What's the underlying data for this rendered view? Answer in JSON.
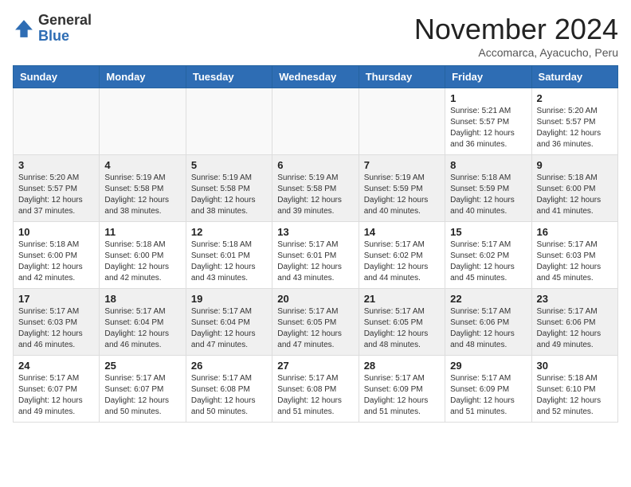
{
  "header": {
    "logo_general": "General",
    "logo_blue": "Blue",
    "month_year": "November 2024",
    "location": "Accomarca, Ayacucho, Peru"
  },
  "weekdays": [
    "Sunday",
    "Monday",
    "Tuesday",
    "Wednesday",
    "Thursday",
    "Friday",
    "Saturday"
  ],
  "weeks": [
    [
      {
        "day": "",
        "info": ""
      },
      {
        "day": "",
        "info": ""
      },
      {
        "day": "",
        "info": ""
      },
      {
        "day": "",
        "info": ""
      },
      {
        "day": "",
        "info": ""
      },
      {
        "day": "1",
        "info": "Sunrise: 5:21 AM\nSunset: 5:57 PM\nDaylight: 12 hours and 36 minutes."
      },
      {
        "day": "2",
        "info": "Sunrise: 5:20 AM\nSunset: 5:57 PM\nDaylight: 12 hours and 36 minutes."
      }
    ],
    [
      {
        "day": "3",
        "info": "Sunrise: 5:20 AM\nSunset: 5:57 PM\nDaylight: 12 hours and 37 minutes."
      },
      {
        "day": "4",
        "info": "Sunrise: 5:19 AM\nSunset: 5:58 PM\nDaylight: 12 hours and 38 minutes."
      },
      {
        "day": "5",
        "info": "Sunrise: 5:19 AM\nSunset: 5:58 PM\nDaylight: 12 hours and 38 minutes."
      },
      {
        "day": "6",
        "info": "Sunrise: 5:19 AM\nSunset: 5:58 PM\nDaylight: 12 hours and 39 minutes."
      },
      {
        "day": "7",
        "info": "Sunrise: 5:19 AM\nSunset: 5:59 PM\nDaylight: 12 hours and 40 minutes."
      },
      {
        "day": "8",
        "info": "Sunrise: 5:18 AM\nSunset: 5:59 PM\nDaylight: 12 hours and 40 minutes."
      },
      {
        "day": "9",
        "info": "Sunrise: 5:18 AM\nSunset: 6:00 PM\nDaylight: 12 hours and 41 minutes."
      }
    ],
    [
      {
        "day": "10",
        "info": "Sunrise: 5:18 AM\nSunset: 6:00 PM\nDaylight: 12 hours and 42 minutes."
      },
      {
        "day": "11",
        "info": "Sunrise: 5:18 AM\nSunset: 6:00 PM\nDaylight: 12 hours and 42 minutes."
      },
      {
        "day": "12",
        "info": "Sunrise: 5:18 AM\nSunset: 6:01 PM\nDaylight: 12 hours and 43 minutes."
      },
      {
        "day": "13",
        "info": "Sunrise: 5:17 AM\nSunset: 6:01 PM\nDaylight: 12 hours and 43 minutes."
      },
      {
        "day": "14",
        "info": "Sunrise: 5:17 AM\nSunset: 6:02 PM\nDaylight: 12 hours and 44 minutes."
      },
      {
        "day": "15",
        "info": "Sunrise: 5:17 AM\nSunset: 6:02 PM\nDaylight: 12 hours and 45 minutes."
      },
      {
        "day": "16",
        "info": "Sunrise: 5:17 AM\nSunset: 6:03 PM\nDaylight: 12 hours and 45 minutes."
      }
    ],
    [
      {
        "day": "17",
        "info": "Sunrise: 5:17 AM\nSunset: 6:03 PM\nDaylight: 12 hours and 46 minutes."
      },
      {
        "day": "18",
        "info": "Sunrise: 5:17 AM\nSunset: 6:04 PM\nDaylight: 12 hours and 46 minutes."
      },
      {
        "day": "19",
        "info": "Sunrise: 5:17 AM\nSunset: 6:04 PM\nDaylight: 12 hours and 47 minutes."
      },
      {
        "day": "20",
        "info": "Sunrise: 5:17 AM\nSunset: 6:05 PM\nDaylight: 12 hours and 47 minutes."
      },
      {
        "day": "21",
        "info": "Sunrise: 5:17 AM\nSunset: 6:05 PM\nDaylight: 12 hours and 48 minutes."
      },
      {
        "day": "22",
        "info": "Sunrise: 5:17 AM\nSunset: 6:06 PM\nDaylight: 12 hours and 48 minutes."
      },
      {
        "day": "23",
        "info": "Sunrise: 5:17 AM\nSunset: 6:06 PM\nDaylight: 12 hours and 49 minutes."
      }
    ],
    [
      {
        "day": "24",
        "info": "Sunrise: 5:17 AM\nSunset: 6:07 PM\nDaylight: 12 hours and 49 minutes."
      },
      {
        "day": "25",
        "info": "Sunrise: 5:17 AM\nSunset: 6:07 PM\nDaylight: 12 hours and 50 minutes."
      },
      {
        "day": "26",
        "info": "Sunrise: 5:17 AM\nSunset: 6:08 PM\nDaylight: 12 hours and 50 minutes."
      },
      {
        "day": "27",
        "info": "Sunrise: 5:17 AM\nSunset: 6:08 PM\nDaylight: 12 hours and 51 minutes."
      },
      {
        "day": "28",
        "info": "Sunrise: 5:17 AM\nSunset: 6:09 PM\nDaylight: 12 hours and 51 minutes."
      },
      {
        "day": "29",
        "info": "Sunrise: 5:17 AM\nSunset: 6:09 PM\nDaylight: 12 hours and 51 minutes."
      },
      {
        "day": "30",
        "info": "Sunrise: 5:18 AM\nSunset: 6:10 PM\nDaylight: 12 hours and 52 minutes."
      }
    ]
  ]
}
